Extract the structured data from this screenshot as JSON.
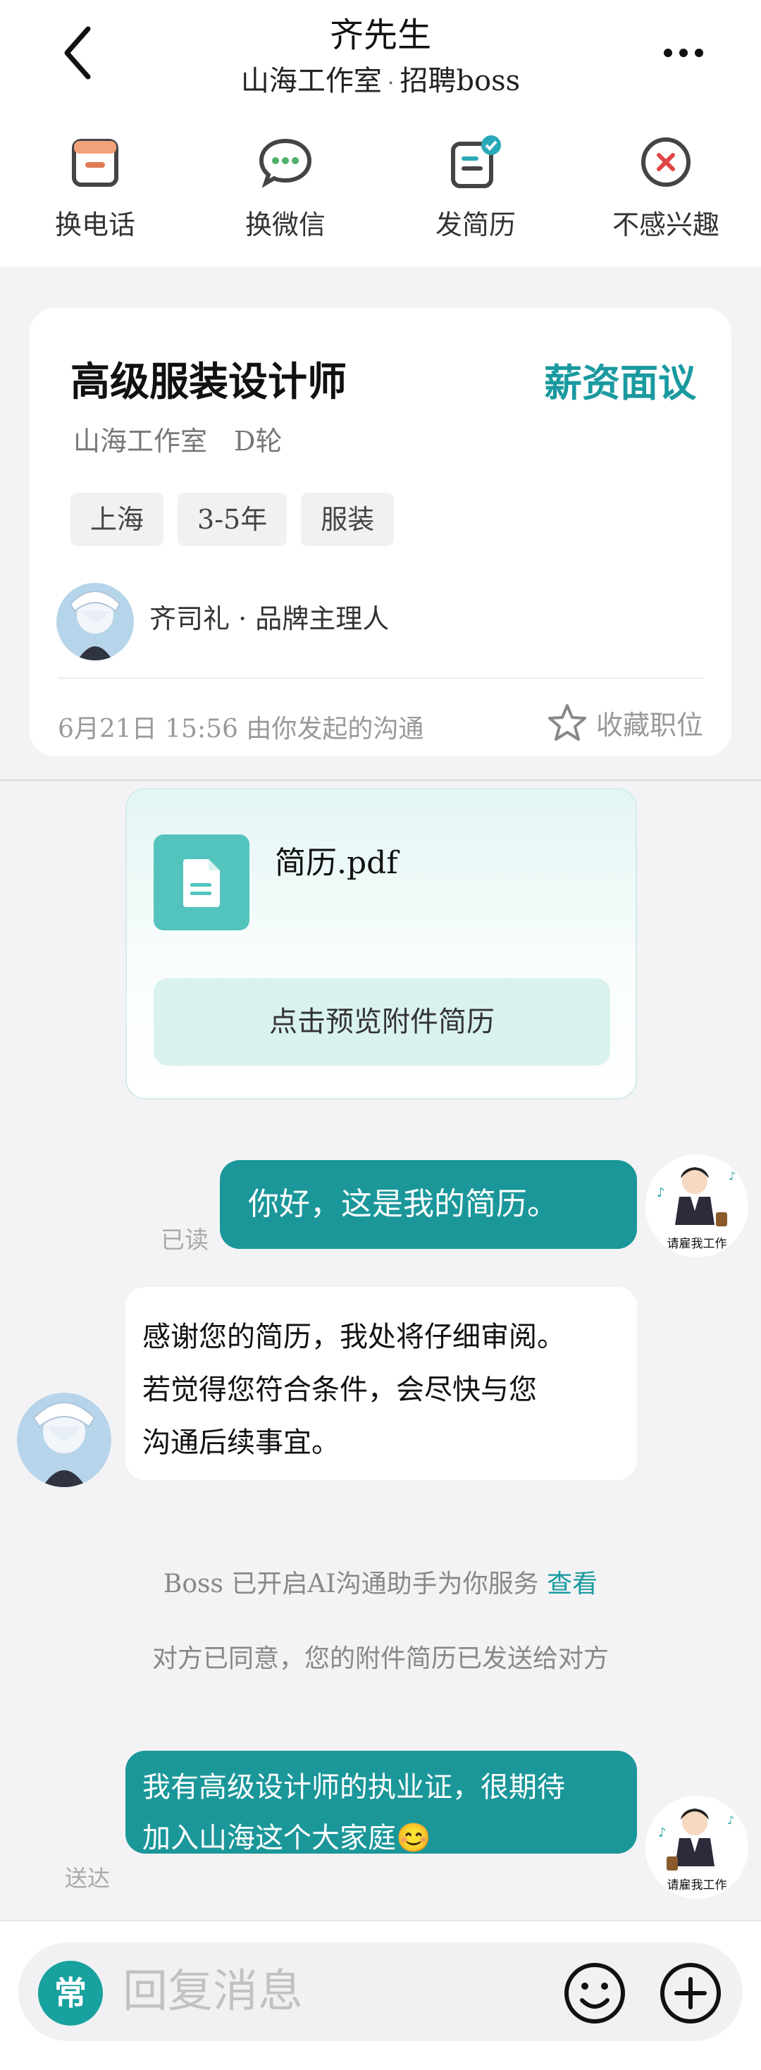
{
  "header": {
    "back_icon": "chevron-left-icon",
    "title": "齐先生",
    "subtitle_company": "山海工作室",
    "subtitle_separator": "·",
    "subtitle_role": "招聘boss",
    "more_icon": "more-dots-icon"
  },
  "actions": [
    {
      "label": "换电话",
      "icon": "phone-swap-icon",
      "color": "#e07a54"
    },
    {
      "label": "换微信",
      "icon": "wechat-icon",
      "color": "#4fb06a"
    },
    {
      "label": "发简历",
      "icon": "resume-send-icon",
      "color": "#2aa9b8"
    },
    {
      "label": "不感兴趣",
      "icon": "not-interested-icon",
      "color": "#e04646"
    }
  ],
  "job": {
    "title": "高级服装设计师",
    "salary": "薪资面议",
    "company": "山海工作室　D轮",
    "tags": [
      "上海",
      "3-5年",
      "服装"
    ],
    "recruiter": "齐司礼 · 品牌主理人",
    "meta": "6月21日 15:56 由你发起的沟通",
    "favorite_label": "收藏职位"
  },
  "resume": {
    "file_name": "简历.pdf",
    "preview_label": "点击预览附件简历"
  },
  "messages": {
    "m1_text": "你好，这是我的简历。",
    "m1_status": "已读",
    "m2_lines": [
      "感谢您的简历，我处将仔细审阅。",
      "若觉得您符合条件，会尽快与您",
      "沟通后续事宜。"
    ],
    "sys1_text": "Boss 已开启AI沟通助手为你服务",
    "sys1_link": "查看",
    "sys2_text": "对方已同意，您的附件简历已发送给对方",
    "m3_lines": [
      "我有高级设计师的执业证，很期待",
      "加入山海这个大家庭😊"
    ],
    "m3_status": "送达",
    "my_avatar_caption": "请雇我工作"
  },
  "input": {
    "common_label": "常",
    "placeholder": "回复消息"
  },
  "colors": {
    "accent": "#1a9aa0",
    "bubble_out": "#1b979a"
  }
}
